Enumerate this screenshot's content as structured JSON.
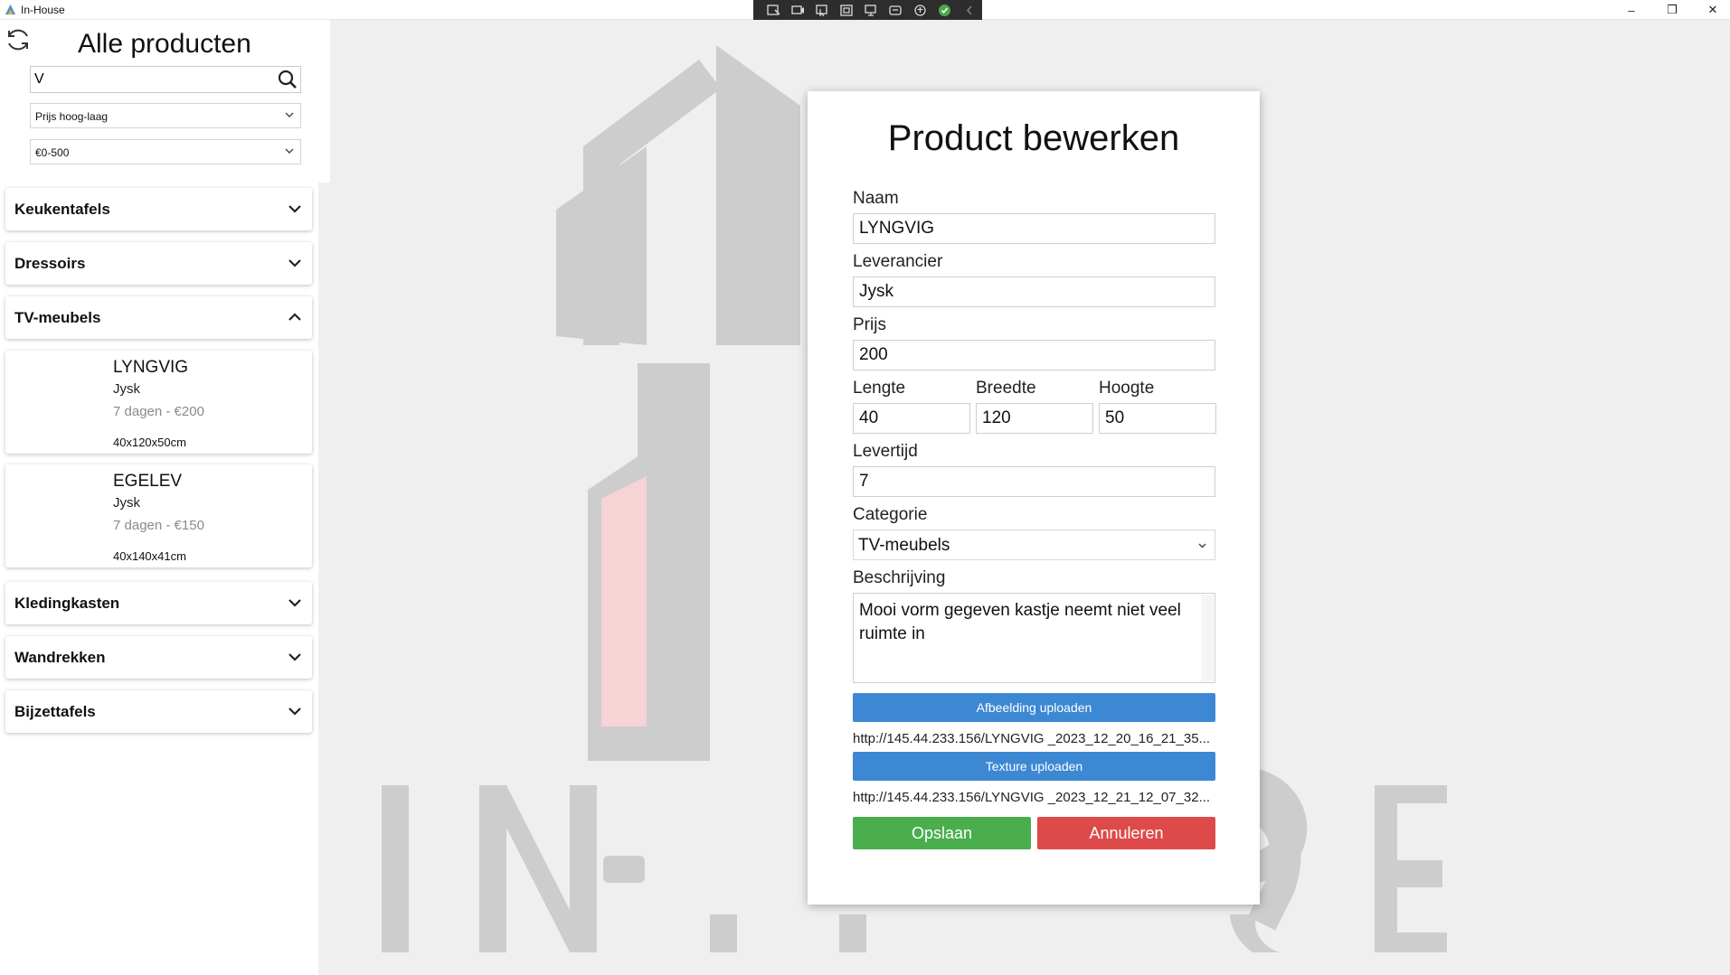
{
  "window": {
    "title": "In-House",
    "minimize": "–",
    "maximize": "❒",
    "close": "✕"
  },
  "sidebar": {
    "title": "Alle producten",
    "search_value": "V",
    "sort_value": "Prijs hoog-laag",
    "price_filter_value": "€0-500",
    "categories": [
      {
        "label": "Keukentafels",
        "expanded": false
      },
      {
        "label": "Dressoirs",
        "expanded": false
      },
      {
        "label": "TV-meubels",
        "expanded": true
      },
      {
        "label": "Kledingkasten",
        "expanded": false
      },
      {
        "label": "Wandrekken",
        "expanded": false
      },
      {
        "label": "Bijzettafels",
        "expanded": false
      }
    ],
    "products": [
      {
        "name": "LYNGVIG",
        "supplier": "Jysk",
        "info": "7 dagen - €200",
        "dims": "40x120x50cm"
      },
      {
        "name": "EGELEV",
        "supplier": "Jysk",
        "info": "7 dagen - €150",
        "dims": "40x140x41cm"
      }
    ]
  },
  "watermark": {
    "text": "IN-HOUSE"
  },
  "modal": {
    "title": "Product bewerken",
    "naam_label": "Naam",
    "naam_value": "LYNGVIG",
    "leverancier_label": "Leverancier",
    "leverancier_value": "Jysk",
    "prijs_label": "Prijs",
    "prijs_value": "200",
    "lengte_label": "Lengte",
    "lengte_value": "40",
    "breedte_label": "Breedte",
    "breedte_value": "120",
    "hoogte_label": "Hoogte",
    "hoogte_value": "50",
    "levertijd_label": "Levertijd",
    "levertijd_value": "7",
    "categorie_label": "Categorie",
    "categorie_value": "TV-meubels",
    "beschrijving_label": "Beschrijving",
    "beschrijving_value": "Mooi vorm gegeven kastje neemt niet veel ruimte in",
    "afbeelding_button": "Afbeelding uploaden",
    "afbeelding_url": "http://145.44.233.156/LYNGVIG _2023_12_20_16_21_35...",
    "texture_button": "Texture uploaden",
    "texture_url": "http://145.44.233.156/LYNGVIG _2023_12_21_12_07_32...",
    "save_button": "Opslaan",
    "cancel_button": "Annuleren"
  },
  "colors": {
    "primary_blue": "#3d88d3",
    "save_green": "#4aae4d",
    "cancel_red": "#dd4a49",
    "watermark_gray": "#cdcdcd",
    "watermark_pink": "#f6d3d4"
  }
}
